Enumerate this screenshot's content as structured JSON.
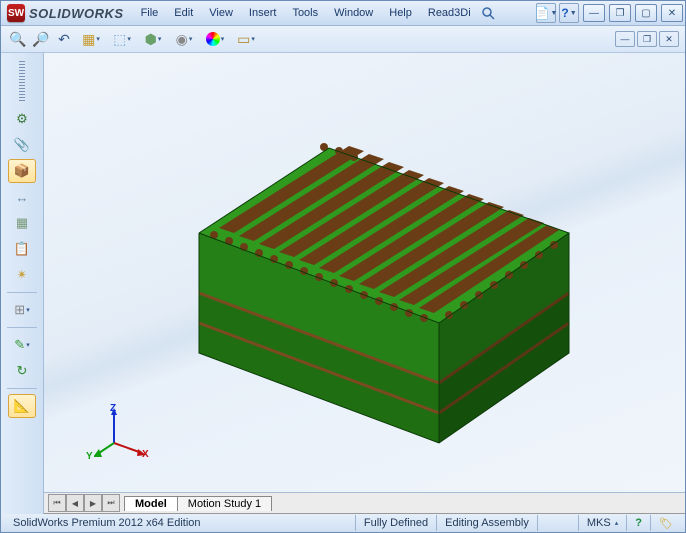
{
  "brand": "SOLIDWORKS",
  "menu": {
    "file": "File",
    "edit": "Edit",
    "view": "View",
    "insert": "Insert",
    "tools": "Tools",
    "window": "Window",
    "help": "Help",
    "read3di": "Read3Di"
  },
  "tabs": {
    "model": "Model",
    "motion": "Motion Study 1"
  },
  "status": {
    "edition": "SolidWorks Premium 2012 x64 Edition",
    "define": "Fully Defined",
    "mode": "Editing Assembly",
    "units": "MKS"
  },
  "triad": {
    "x": "X",
    "y": "Y",
    "z": "Z"
  }
}
